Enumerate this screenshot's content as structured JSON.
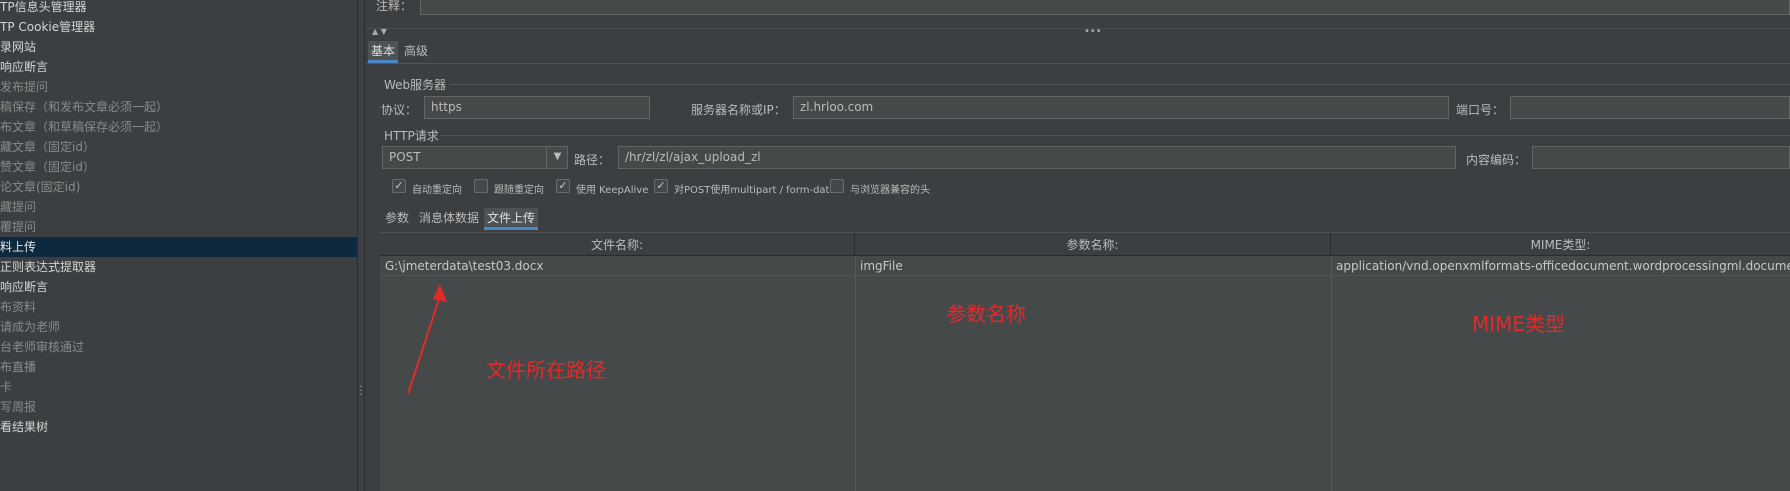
{
  "tree": {
    "items": [
      {
        "label": "TP信息头管理器",
        "tone": "bright"
      },
      {
        "label": "TP Cookie管理器",
        "tone": "bright"
      },
      {
        "label": "录网站",
        "tone": "bright"
      },
      {
        "label": " 响应断言",
        "tone": "bright"
      },
      {
        "label": "发布提问",
        "tone": "dim"
      },
      {
        "label": "稿保存（和发布文章必须一起）",
        "tone": "dim"
      },
      {
        "label": "布文章（和草稿保存必须一起）",
        "tone": "dim"
      },
      {
        "label": "藏文章（固定id）",
        "tone": "dim"
      },
      {
        "label": "赞文章（固定id）",
        "tone": "dim"
      },
      {
        "label": "论文章(固定id)",
        "tone": "dim"
      },
      {
        "label": "藏提问",
        "tone": "dim"
      },
      {
        "label": "覆提问",
        "tone": "dim"
      },
      {
        "label": "料上传",
        "tone": "selected"
      },
      {
        "label": " 正则表达式提取器",
        "tone": "bright"
      },
      {
        "label": " 响应断言",
        "tone": "bright"
      },
      {
        "label": "布资料",
        "tone": "dim"
      },
      {
        "label": "请成为老师",
        "tone": "dim"
      },
      {
        "label": "台老师审核通过",
        "tone": "dim"
      },
      {
        "label": "布直播",
        "tone": "dim"
      },
      {
        "label": "卡",
        "tone": "dim"
      },
      {
        "label": "写周报",
        "tone": "dim"
      },
      {
        "label": "看结果树",
        "tone": "bright"
      }
    ]
  },
  "comment": {
    "label": "注释：",
    "value": ""
  },
  "config_tabs": {
    "basic": "基本",
    "advanced": "高级"
  },
  "web_server": {
    "section_title": "Web服务器",
    "protocol_label": "协议：",
    "protocol_value": "https",
    "server_label": "服务器名称或IP：",
    "server_value": "zl.hrloo.com",
    "port_label": "端口号：",
    "port_value": ""
  },
  "http_request": {
    "section_title": "HTTP请求",
    "method": "POST",
    "path_label": "路径：",
    "path_value": "/hr/zl/zl/ajax_upload_zl",
    "encoding_label": "内容编码：",
    "encoding_value": ""
  },
  "options": [
    {
      "label": "自动重定向",
      "checked": true
    },
    {
      "label": "跟随重定向",
      "checked": false
    },
    {
      "label": "使用 KeepAlive",
      "checked": true
    },
    {
      "label": "对POST使用multipart / form-data",
      "checked": true
    },
    {
      "label": "与浏览器兼容的头",
      "checked": false
    }
  ],
  "body_tabs": {
    "params": "参数",
    "body_data": "消息体数据",
    "file_upload": "文件上传"
  },
  "file_table": {
    "headers": [
      "文件名称:",
      "参数名称:",
      "MIME类型:"
    ],
    "rows": [
      [
        "G:\\jmeterdata\\test03.docx",
        "imgFile",
        "application/vnd.openxmlformats-officedocument.wordprocessingml.document"
      ]
    ]
  },
  "annotations": {
    "file_path": "文件所在路径",
    "param_name": "参数名称",
    "mime_type": "MIME类型"
  },
  "colors": {
    "background": "#3c3f41",
    "selection": "#0d293e",
    "accent": "#4a88c7",
    "annotation": "#e32a2a"
  }
}
